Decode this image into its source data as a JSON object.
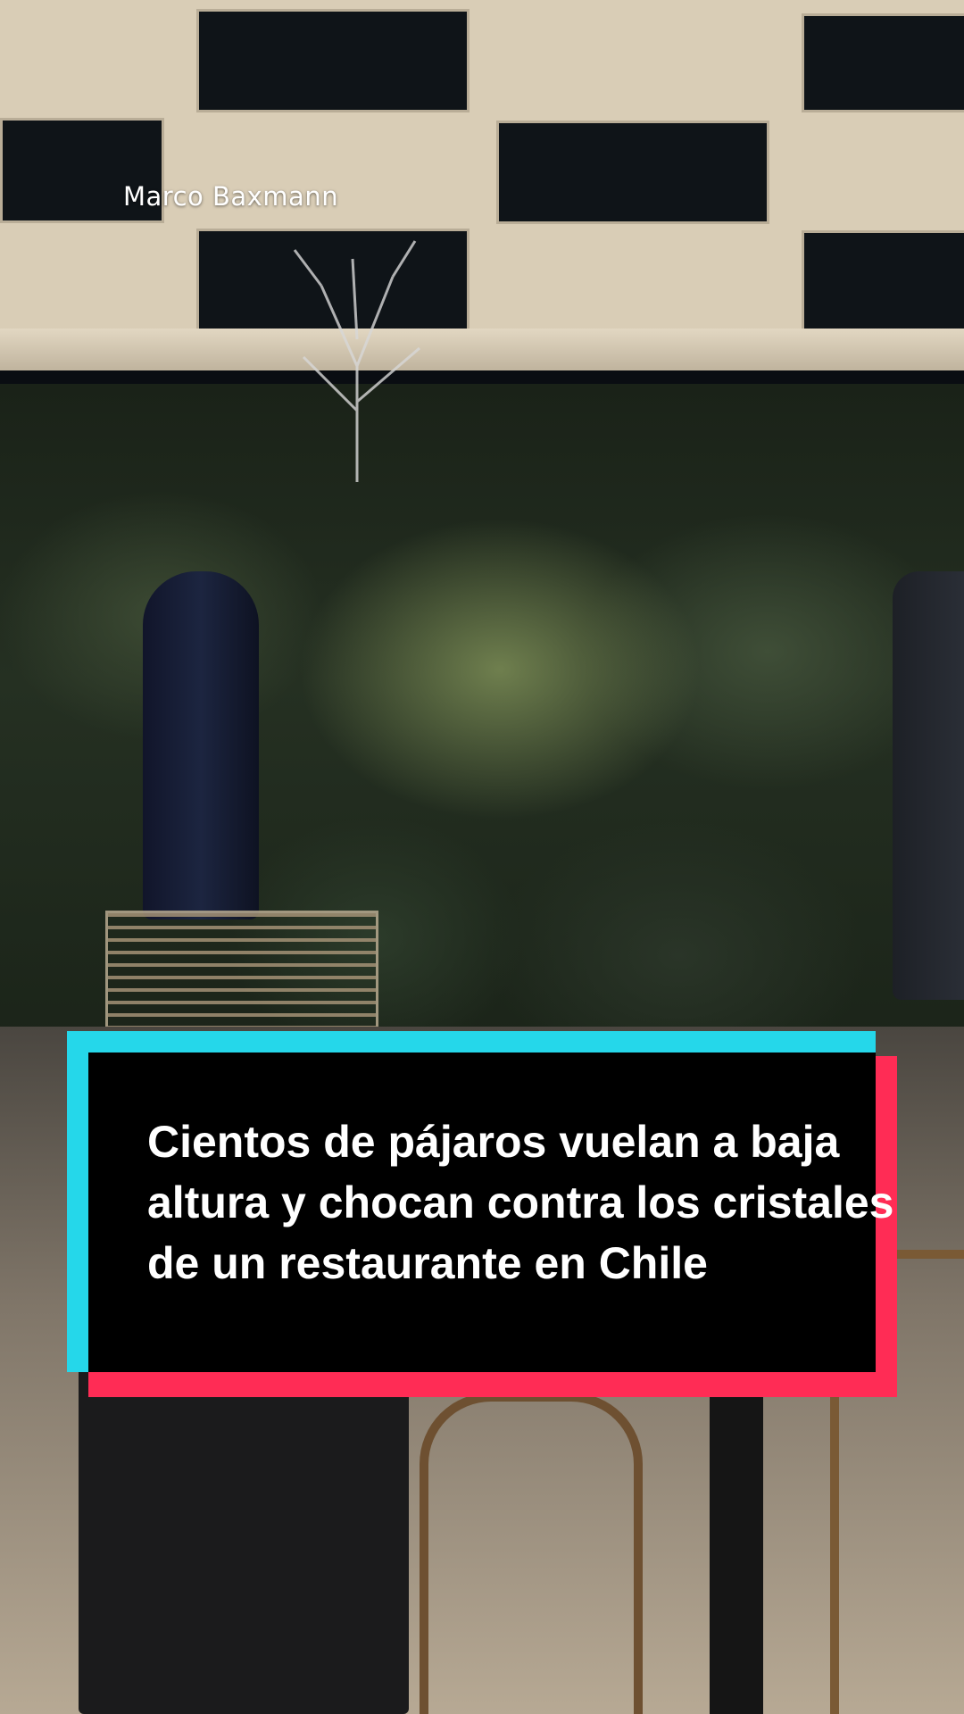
{
  "watermark": {
    "text": "Marco Baxmann"
  },
  "caption": {
    "text": "Cientos de pájaros vuelan a baja altura y chocan contra los cristales de un restaurante en Chile",
    "colors": {
      "background": "#000000",
      "accent_cyan": "#25d7ea",
      "accent_red": "#ff2c55",
      "text": "#ffffff"
    }
  }
}
